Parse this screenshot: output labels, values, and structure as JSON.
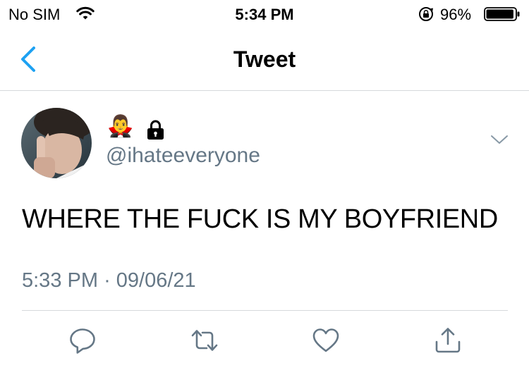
{
  "status_bar": {
    "carrier": "No SIM",
    "time": "5:34 PM",
    "battery_percent": "96%",
    "battery_level": 0.96,
    "icons": [
      "wifi-icon",
      "orientation-lock-icon",
      "battery-icon"
    ]
  },
  "nav": {
    "title": "Tweet",
    "back_icon": "chevron-left-icon",
    "accent_color": "#1da1f2"
  },
  "tweet": {
    "display_name": "🧛‍♂️",
    "protected_icon": "lock-icon",
    "handle": "@ihateeveryone",
    "text": "WHERE THE FUCK IS MY BOYFRIEND",
    "time": "5:33 PM",
    "separator": "·",
    "date": "09/06/21",
    "more_icon": "chevron-down-icon"
  },
  "actions": [
    {
      "name": "reply",
      "icon": "reply-icon"
    },
    {
      "name": "retweet",
      "icon": "retweet-icon"
    },
    {
      "name": "like",
      "icon": "heart-icon"
    },
    {
      "name": "share",
      "icon": "share-icon"
    }
  ],
  "colors": {
    "secondary_text": "#657786",
    "divider": "#d6d9db",
    "icon_gray": "#657786"
  }
}
